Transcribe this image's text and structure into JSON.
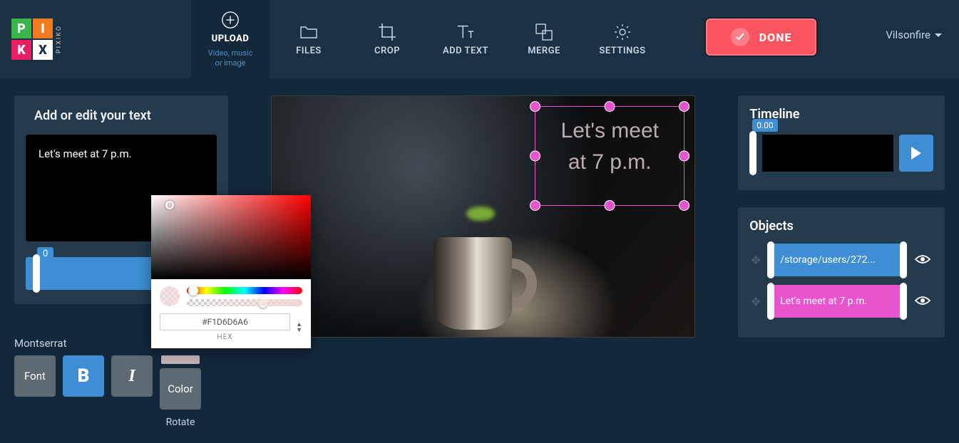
{
  "header": {
    "logo_letters": [
      "P",
      "I",
      "X",
      "K"
    ],
    "logo_side": "PIXIKO",
    "user": "Vilsonfire",
    "done_label": "DONE",
    "nav": {
      "upload": {
        "label": "UPLOAD",
        "sub": "Video, music\nor image"
      },
      "files": "FILES",
      "crop": "CROP",
      "addtext": "ADD TEXT",
      "merge": "MERGE",
      "settings": "SETTINGS"
    }
  },
  "editor": {
    "title": "Add or edit your text",
    "text_value": "Let's meet at 7 p.m.",
    "slider_value": "0",
    "font_name": "Montserrat",
    "buttons": {
      "font": "Font",
      "bold": "B",
      "italic": "I",
      "color": "Color"
    },
    "rotate_label": "Rotate"
  },
  "colorpicker": {
    "hex": "#F1D6D6A6",
    "hex_label": "HEX"
  },
  "canvas": {
    "overlay_line1": "Let's meet",
    "overlay_line2": "at 7 p.m."
  },
  "timeline": {
    "title": "Timeline",
    "position": "0.00"
  },
  "objects": {
    "title": "Objects",
    "items": [
      {
        "label": "/storage/users/272...",
        "color": "blue"
      },
      {
        "label": "Let's meet at 7 p.m.",
        "color": "pink"
      }
    ]
  }
}
